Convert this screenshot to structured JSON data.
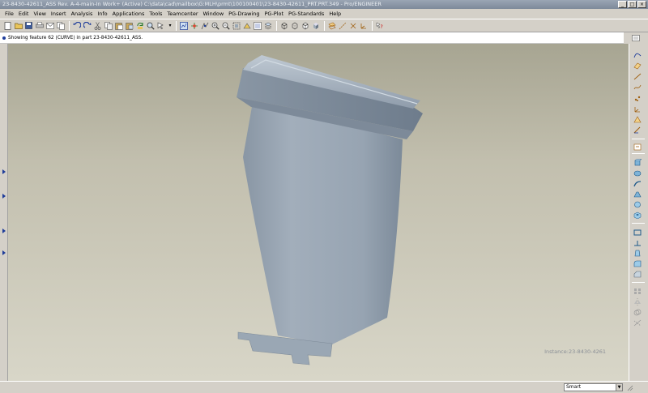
{
  "window": {
    "title": "23-8430-42611_ASS Rev. A-4-main-In Work+ (Active) C:\\data\\cad\\mailbox\\G:MLH\\prmt\\100100401\\23-8430-42611_PRT.PRT.349 - Pro/ENGINEER",
    "controls": [
      "_",
      "□",
      "×"
    ]
  },
  "menubar": {
    "items": [
      "File",
      "Edit",
      "View",
      "Insert",
      "Analysis",
      "Info",
      "Applications",
      "Tools",
      "Teamcenter",
      "Window",
      "PG-Drawing",
      "PG-Plot",
      "PG-Standards",
      "Help"
    ]
  },
  "message": {
    "text": "Showing feature 62 (CURVE) in part 23-8430-42611_ASS."
  },
  "viewport": {
    "instance_label": "Instance:23-8430-4261"
  },
  "statusbar": {
    "filter_value": "Smart"
  },
  "colors": {
    "accent": "#1e3c9a",
    "part_surface": "#9aa7b4",
    "background_top": "#a7a592",
    "background_bottom": "#d8d6c8"
  },
  "icons": {
    "toolbar": [
      "new-icon",
      "open-icon",
      "save-icon",
      "print-icon",
      "email-icon",
      "copy-icon",
      "undo-icon",
      "redo-icon",
      "cut-icon",
      "copy2-icon",
      "paste-icon",
      "paste-special-icon",
      "regenerate-icon",
      "find-icon",
      "select-icon",
      "repaint-icon",
      "spin-center-icon",
      "orient-icon",
      "zoom-in-icon",
      "zoom-out-icon",
      "refit-icon",
      "reorient-icon",
      "saved-views-icon",
      "layers-icon",
      "wireframe-icon",
      "hidden-line-icon",
      "no-hidden-icon",
      "shading-icon",
      "datum-planes-icon",
      "datum-axes-icon",
      "point-icon",
      "csys-icon",
      "whats-this-icon"
    ],
    "right": [
      "sketch-curve-icon",
      "plane-icon",
      "axis-icon",
      "curve-icon",
      "point-icon",
      "csys-icon",
      "analysis-icon",
      "sketch-icon",
      "insert-tool-icon",
      "extrude-icon",
      "revolve-icon",
      "variable-sweep-icon",
      "blend-icon",
      "style-icon",
      "hole-icon",
      "shell-icon",
      "rib-icon",
      "draft-icon",
      "round-icon",
      "chamfer-icon",
      "pattern-icon",
      "mirror-icon",
      "merge-icon",
      "trim-icon"
    ]
  }
}
